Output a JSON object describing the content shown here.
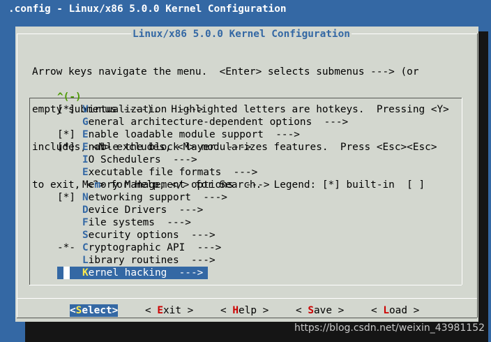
{
  "window": {
    "title": ".config - Linux/x86 5.0.0 Kernel Configuration"
  },
  "dialog": {
    "title": "Linux/x86 5.0.0 Kernel Configuration",
    "help_lines": [
      "Arrow keys navigate the menu.  <Enter> selects submenus ---> (or",
      "empty submenus ----).  Highlighted letters are hotkeys.  Pressing <Y>",
      "includes, <N> excludes, <M> modularizes features.  Press <Esc><Esc>",
      "to exit, <?> for Help, </> for Search.  Legend: [*] built-in  [ ]"
    ],
    "scroll_indicator": "^(-)"
  },
  "menu": {
    "items": [
      {
        "marker": "[*]",
        "hotkey": "V",
        "rest": "irtualization  --->"
      },
      {
        "marker": "",
        "hotkey": "G",
        "rest": "eneral architecture-dependent options  --->"
      },
      {
        "marker": "[*]",
        "hotkey": "E",
        "rest": "nable loadable module support  --->"
      },
      {
        "marker": "[*]",
        "hotkey": "E",
        "rest": "nable the block layer  --->"
      },
      {
        "marker": "",
        "hotkey": "I",
        "rest": "O Schedulers  --->"
      },
      {
        "marker": "",
        "hotkey": "E",
        "rest": "xecutable file formats  --->"
      },
      {
        "marker": "",
        "pre": "Me",
        "hotkey": "m",
        "rest": "ory Management options  --->"
      },
      {
        "marker": "[*]",
        "hotkey": "N",
        "rest": "etworking support  --->"
      },
      {
        "marker": "",
        "hotkey": "D",
        "rest": "evice Drivers  --->"
      },
      {
        "marker": "",
        "hotkey": "F",
        "rest": "ile systems  --->"
      },
      {
        "marker": "",
        "hotkey": "S",
        "rest": "ecurity options  --->"
      },
      {
        "marker": "-*-",
        "hotkey": "C",
        "rest": "ryptographic API  --->"
      },
      {
        "marker": "",
        "hotkey": "L",
        "rest": "ibrary routines  --->"
      },
      {
        "marker": "",
        "hotkey": "K",
        "rest": "ernel hacking  --->",
        "selected": true
      }
    ]
  },
  "buttons": [
    {
      "open": "<",
      "hotkey": "S",
      "rest": "elect",
      "close": ">",
      "active": true
    },
    {
      "open": "< ",
      "hotkey": "E",
      "rest": "xit",
      "close": " >"
    },
    {
      "open": "< ",
      "hotkey": "H",
      "rest": "elp",
      "close": " >"
    },
    {
      "open": "< ",
      "hotkey": "S",
      "rest": "ave",
      "close": " >"
    },
    {
      "open": "< ",
      "hotkey": "L",
      "rest": "oad",
      "close": " >"
    }
  ],
  "watermark": "https://blog.csdn.net/weixin_43981152"
}
